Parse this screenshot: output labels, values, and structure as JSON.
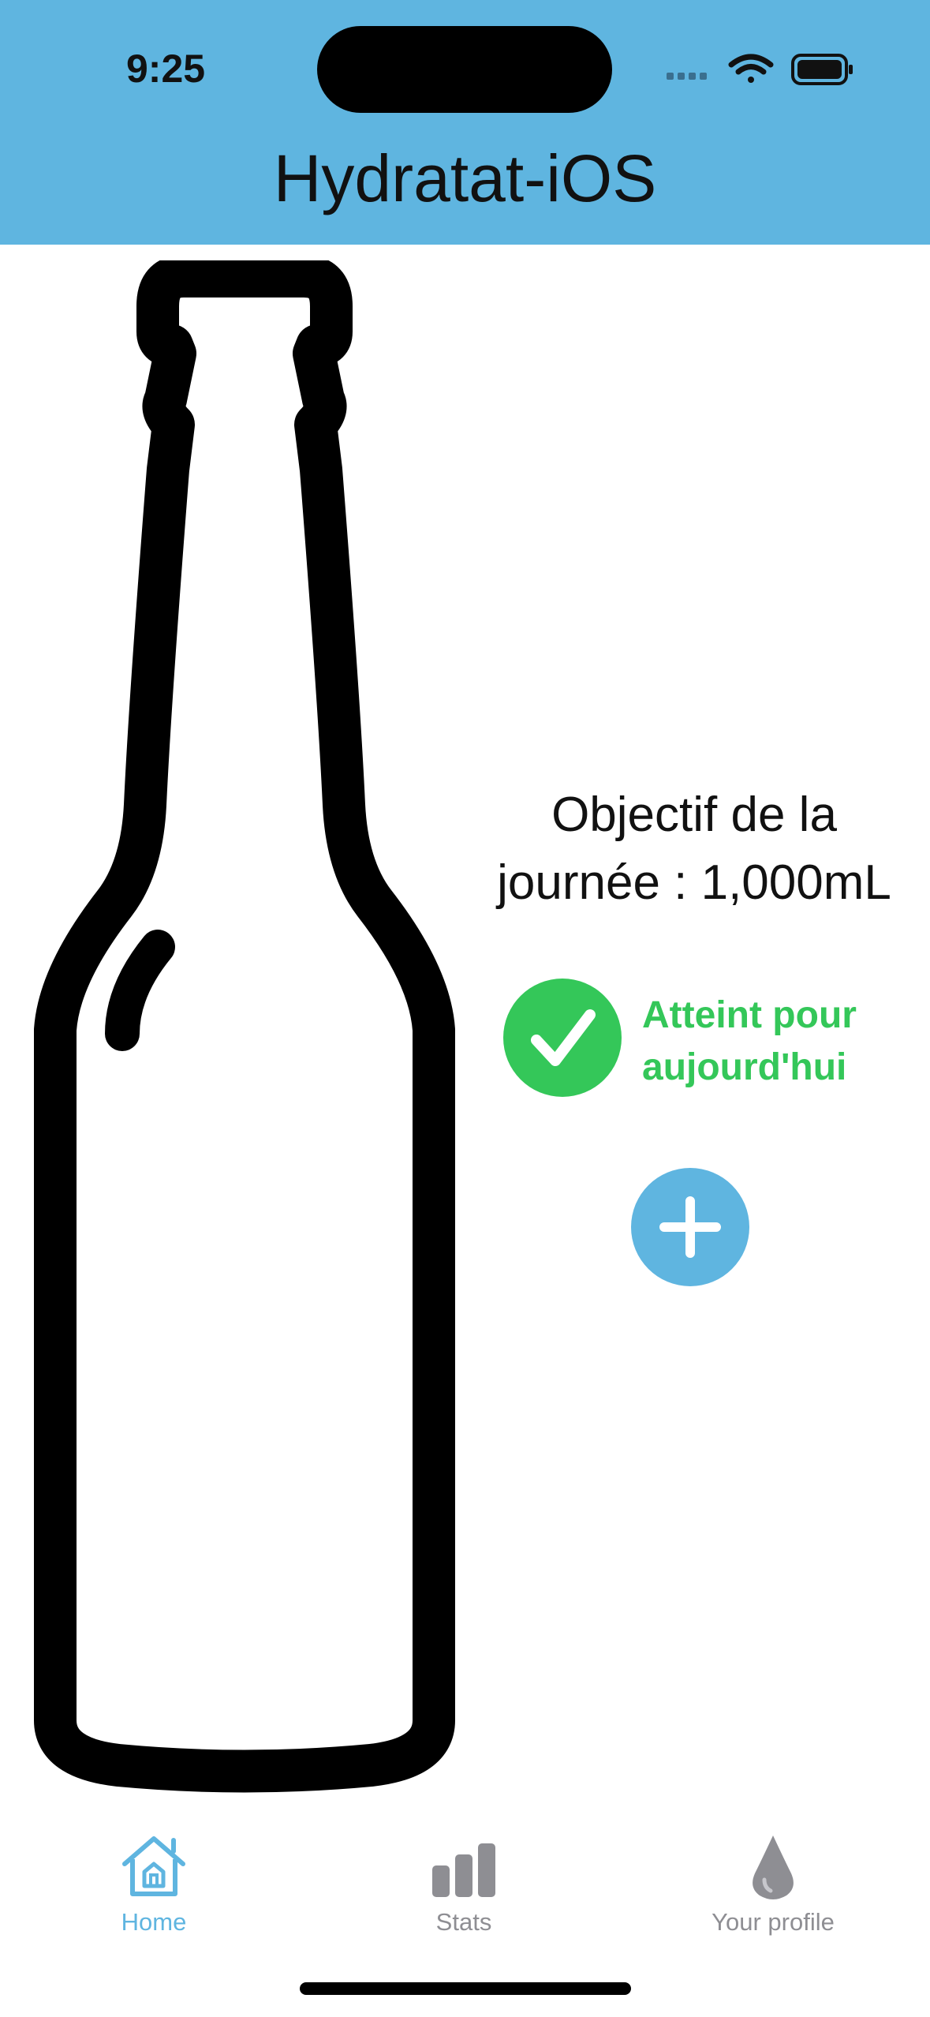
{
  "status_bar": {
    "time": "9:25"
  },
  "header": {
    "title": "Hydratat-iOS",
    "color": "#5fb5e0"
  },
  "goal": {
    "line1": "Objectif  de la",
    "line2": "journée : 1,000mL"
  },
  "status": {
    "label_line1": "Atteint pour",
    "label_line2": "aujourd'hui",
    "color": "#34c759",
    "icon": "checkmark-icon"
  },
  "add_button": {
    "icon": "plus-icon",
    "color": "#5fb5e0"
  },
  "tabs": [
    {
      "label": "Home",
      "icon": "house-icon",
      "active": true,
      "color": "#5fb5e0"
    },
    {
      "label": "Stats",
      "icon": "bar-chart-icon",
      "active": false,
      "color": "#8e8e93"
    },
    {
      "label": "Your profile",
      "icon": "water-drop-icon",
      "active": false,
      "color": "#8e8e93"
    }
  ]
}
